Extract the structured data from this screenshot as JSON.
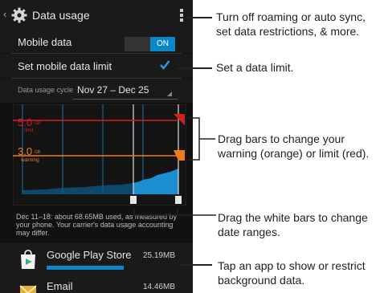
{
  "header": {
    "back_glyph": "‹",
    "title": "Data usage",
    "settings_icon": "gear-icon",
    "menu_icon": "overflow-menu-icon"
  },
  "mobile_data": {
    "label": "Mobile data",
    "toggle": "ON"
  },
  "limit": {
    "label": "Set mobile data limit",
    "checked": true
  },
  "cycle": {
    "label": "Data usage cycle",
    "value": "Nov 27 – Dec 25"
  },
  "chart_labels": {
    "limit_value": "5.0",
    "limit_unit": "GB",
    "limit_word": "limit",
    "warning_value": "3.0",
    "warning_unit": "GB",
    "warning_word": "warning"
  },
  "usage_info": "Dec 11–18: about 68.65MB used, as measured by your phone. Your carrier's data usage accounting may differ.",
  "apps": [
    {
      "name": "Google Play Store",
      "size": "25.19MB",
      "usage_fraction": 0.55
    },
    {
      "name": "Email",
      "size": "14.46MB"
    }
  ],
  "callouts": {
    "menu": "Turn off roaming or auto sync, set data restrictions, & more.",
    "limit": "Set a data limit.",
    "drag_bars": "Drag bars to change your warning (orange) or limit (red).",
    "white_bars": "Drag the white bars to change date ranges.",
    "app": "Tap an app to show or restrict background data."
  },
  "colors": {
    "accent": "#0b86c8",
    "limit": "#d32020",
    "warning": "#ef7d17",
    "background": "#111111"
  }
}
